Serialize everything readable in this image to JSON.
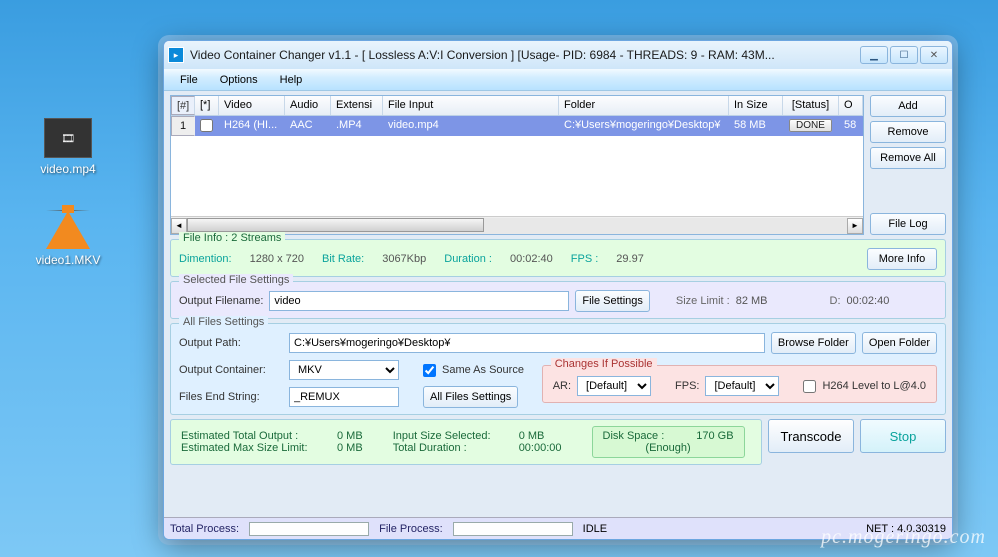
{
  "desktop": {
    "icons": [
      {
        "label": "video.mp4"
      },
      {
        "label": "video1.MKV"
      }
    ]
  },
  "window": {
    "title": "Video Container Changer v1.1 - [ Lossless A:V:I Conversion ] [Usage- PID: 6984 - THREADS: 9 - RAM: 43M..."
  },
  "menu": {
    "file": "File",
    "options": "Options",
    "help": "Help"
  },
  "grid": {
    "headers": {
      "n": "[#]",
      "chk": "[*]",
      "video": "Video",
      "audio": "Audio",
      "ext": "Extensi",
      "fileinput": "File Input",
      "folder": "Folder",
      "insize": "In Size",
      "status": "[Status]",
      "out": "O"
    },
    "rows": [
      {
        "n": "1",
        "video": "H264 (HI...",
        "audio": "AAC",
        "ext": ".MP4",
        "fileinput": "video.mp4",
        "folder": "C:¥Users¥mogeringo¥Desktop¥",
        "insize": "58 MB",
        "status": "DONE",
        "out": "58"
      }
    ]
  },
  "sidebar": {
    "add": "Add",
    "remove": "Remove",
    "removeall": "Remove All",
    "filelog": "File Log"
  },
  "fileinfo": {
    "legend": "File Info : 2 Streams",
    "dim_lbl": "Dimention:",
    "dim_val": "1280 x 720",
    "br_lbl": "Bit Rate:",
    "br_val": "3067Kbp",
    "dur_lbl": "Duration :",
    "dur_val": "00:02:40",
    "fps_lbl": "FPS :",
    "fps_val": "29.97",
    "moreinfo": "More Info"
  },
  "selected": {
    "legend": "Selected File Settings",
    "outname_lbl": "Output Filename:",
    "outname_val": "video",
    "filesettings": "File Settings",
    "sizelimit_lbl": "Size Limit :",
    "sizelimit_val": "82 MB",
    "d_lbl": "D:",
    "d_val": "00:02:40"
  },
  "allfiles": {
    "legend": "All Files Settings",
    "path_lbl": "Output Path:",
    "path_val": "C:¥Users¥mogeringo¥Desktop¥",
    "browse": "Browse Folder",
    "open": "Open Folder",
    "container_lbl": "Output Container:",
    "container_val": "MKV",
    "same_src": "Same As Source",
    "endstr_lbl": "Files End String:",
    "endstr_val": "_REMUX",
    "allsettings": "All Files Settings",
    "changes": {
      "legend": "Changes If Possible",
      "ar_lbl": "AR:",
      "ar_val": "[Default]",
      "fps_lbl": "FPS:",
      "fps_val": "[Default]",
      "h264": "H264 Level to L@4.0"
    }
  },
  "estimate": {
    "eto_lbl": "Estimated Total Output :",
    "eto_val": "0 MB",
    "eml_lbl": "Estimated Max Size Limit:",
    "eml_val": "0 MB",
    "iss_lbl": "Input Size Selected:",
    "iss_val": "0 MB",
    "td_lbl": "Total Duration :",
    "td_val": "00:00:00",
    "ds_lbl": "Disk Space :",
    "ds_val": "170 GB",
    "ds_sub": "(Enough)",
    "transcode": "Transcode",
    "stop": "Stop"
  },
  "status": {
    "tp": "Total Process:",
    "fp": "File Process:",
    "idle": "IDLE",
    "net": "NET :  4.0.30319"
  },
  "watermark": "pc.mogeringo.com"
}
